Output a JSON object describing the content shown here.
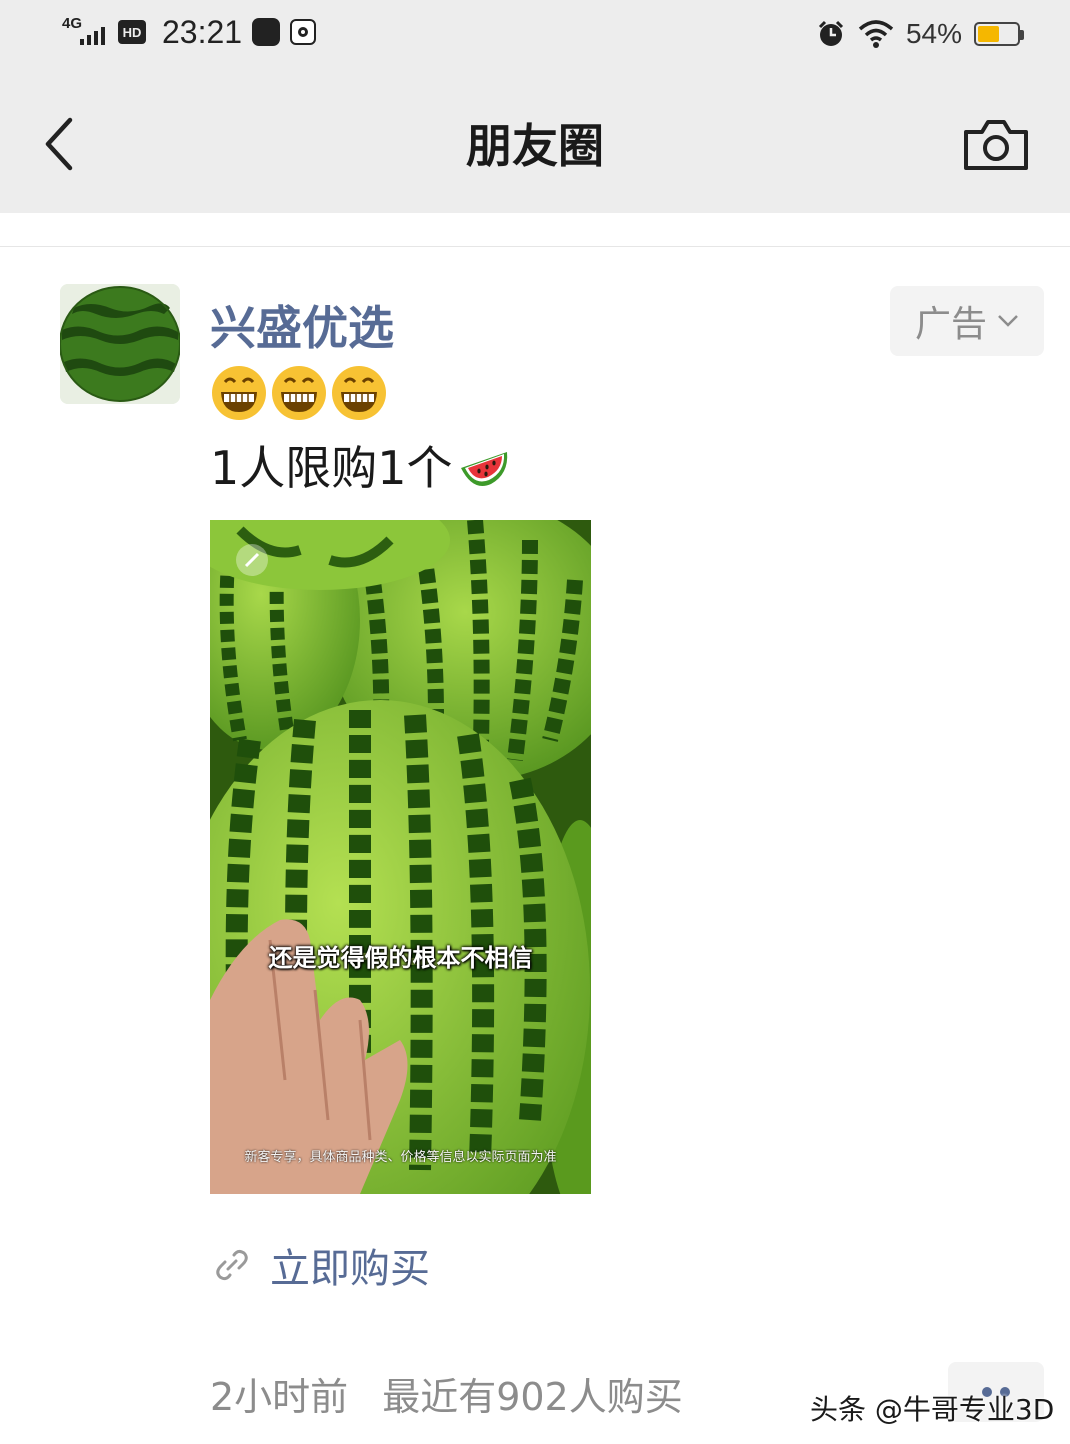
{
  "status_bar": {
    "network": "4G",
    "hd_label": "HD",
    "time": "23:21",
    "battery_text": "54%",
    "battery_level": 0.54,
    "icons": [
      "signal-icon",
      "hd-icon",
      "app-icon",
      "notification-icon",
      "alarm-icon",
      "wifi-icon",
      "battery-icon"
    ]
  },
  "nav": {
    "title": "朋友圈",
    "back_icon": "chevron-left-icon",
    "camera_icon": "camera-icon"
  },
  "post": {
    "author": "兴盛优选",
    "ad_label": "广告",
    "emojis": [
      "grinning-face-emoji",
      "grinning-face-emoji",
      "grinning-face-emoji"
    ],
    "text": "1人限购1个",
    "text_emoji": "watermelon-emoji",
    "media": {
      "caption": "还是觉得假的根本不相信",
      "subcaption": "新客专享，具体商品种类、价格等信息以实际页面为准"
    },
    "cta": "立即购买",
    "time_ago": "2小时前",
    "stats": "最近有902人购买"
  },
  "watermark": "头条 @牛哥专业3D",
  "colors": {
    "link_blue": "#576b95",
    "gray_text": "#8c8c8c",
    "bar_bg": "#ededed",
    "battery": "#f5b700"
  }
}
